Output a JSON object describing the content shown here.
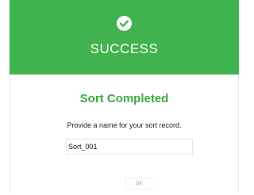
{
  "dialog": {
    "header": {
      "icon": "checkmark-circle-icon",
      "title": "SUCCESS",
      "color": "#40b34f"
    },
    "subtitle": "Sort Completed",
    "subtitle_color": "#3cab3c",
    "prompt": "Provide a name for your sort record.",
    "name_input": {
      "value": "Sort_001"
    },
    "ok_label": "OK"
  }
}
